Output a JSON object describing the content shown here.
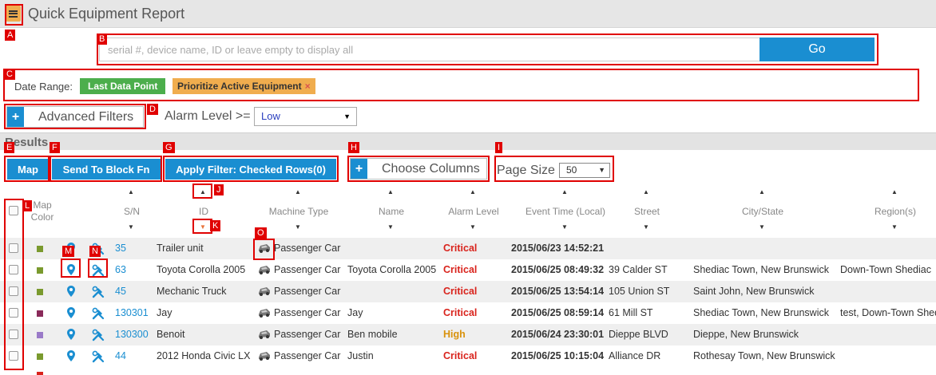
{
  "header": {
    "title": "Quick Equipment Report"
  },
  "search": {
    "placeholder": "serial #, device name, ID or leave empty to display all",
    "go_label": "Go"
  },
  "date_range": {
    "label": "Date Range:",
    "chip_last": "Last Data Point",
    "chip_prioritize": "Prioritize Active Equipment",
    "chip_remove": "×"
  },
  "filters": {
    "advanced_label": "Advanced Filters",
    "alarm_label": "Alarm Level >=",
    "alarm_value": "Low"
  },
  "results": {
    "title": "Results"
  },
  "toolbar": {
    "map": "Map",
    "send_block": "Send To Block Fn",
    "apply_filter": "Apply Filter: Checked Rows(0)",
    "choose_columns": "Choose Columns",
    "page_size_label": "Page Size",
    "page_size_value": "50"
  },
  "columns": {
    "map_color": "Map Color",
    "sn": "S/N",
    "id": "ID",
    "machine_type": "Machine Type",
    "name": "Name",
    "alarm_level": "Alarm Level",
    "event_time": "Event Time (Local)",
    "street": "Street",
    "city_state": "City/State",
    "region": "Region(s)"
  },
  "annotations": [
    "A",
    "B",
    "C",
    "D",
    "E",
    "F",
    "G",
    "H",
    "I",
    "J",
    "K",
    "L",
    "M",
    "N",
    "O"
  ],
  "colors": {
    "accent": "#1a8ed1",
    "critical": "#d9231c",
    "high": "#d9920c",
    "menu": "#f0ad4e",
    "green": "#4cae4c"
  },
  "rows": [
    {
      "color": "#7a9a2e",
      "sn": "35",
      "id": "Trailer unit",
      "type": "Passenger Car",
      "name": "",
      "alarm": "Critical",
      "time": "2015/06/23 14:52:21",
      "street": "",
      "city": "",
      "region": ""
    },
    {
      "color": "#7a9a2e",
      "sn": "63",
      "id": "Toyota Corolla 2005",
      "type": "Passenger Car",
      "name": "Toyota Corolla 2005",
      "alarm": "Critical",
      "time": "2015/06/25 08:49:32",
      "street": "39 Calder ST",
      "city": "Shediac Town, New Brunswick",
      "region": "Down-Town Shediac"
    },
    {
      "color": "#7a9a2e",
      "sn": "45",
      "id": "Mechanic Truck",
      "type": "Passenger Car",
      "name": "",
      "alarm": "Critical",
      "time": "2015/06/25 13:54:14",
      "street": "105 Union ST",
      "city": "Saint John, New Brunswick",
      "region": ""
    },
    {
      "color": "#8a2a5a",
      "sn": "130301",
      "id": "Jay",
      "type": "Passenger Car",
      "name": "Jay",
      "alarm": "Critical",
      "time": "2015/06/25 08:59:14",
      "street": "61 Mill ST",
      "city": "Shediac Town, New Brunswick",
      "region": "test, Down-Town Shed"
    },
    {
      "color": "#9a7ac8",
      "sn": "130300",
      "id": "Benoit",
      "type": "Passenger Car",
      "name": "Ben mobile",
      "alarm": "High",
      "time": "2015/06/24 23:30:01",
      "street": "Dieppe BLVD",
      "city": "Dieppe, New Brunswick",
      "region": ""
    },
    {
      "color": "#7a9a2e",
      "sn": "44",
      "id": "2012 Honda Civic LX",
      "type": "Passenger Car",
      "name": "Justin",
      "alarm": "Critical",
      "time": "2015/06/25 10:15:04",
      "street": "Alliance DR",
      "city": "Rothesay Town, New Brunswick",
      "region": ""
    }
  ]
}
